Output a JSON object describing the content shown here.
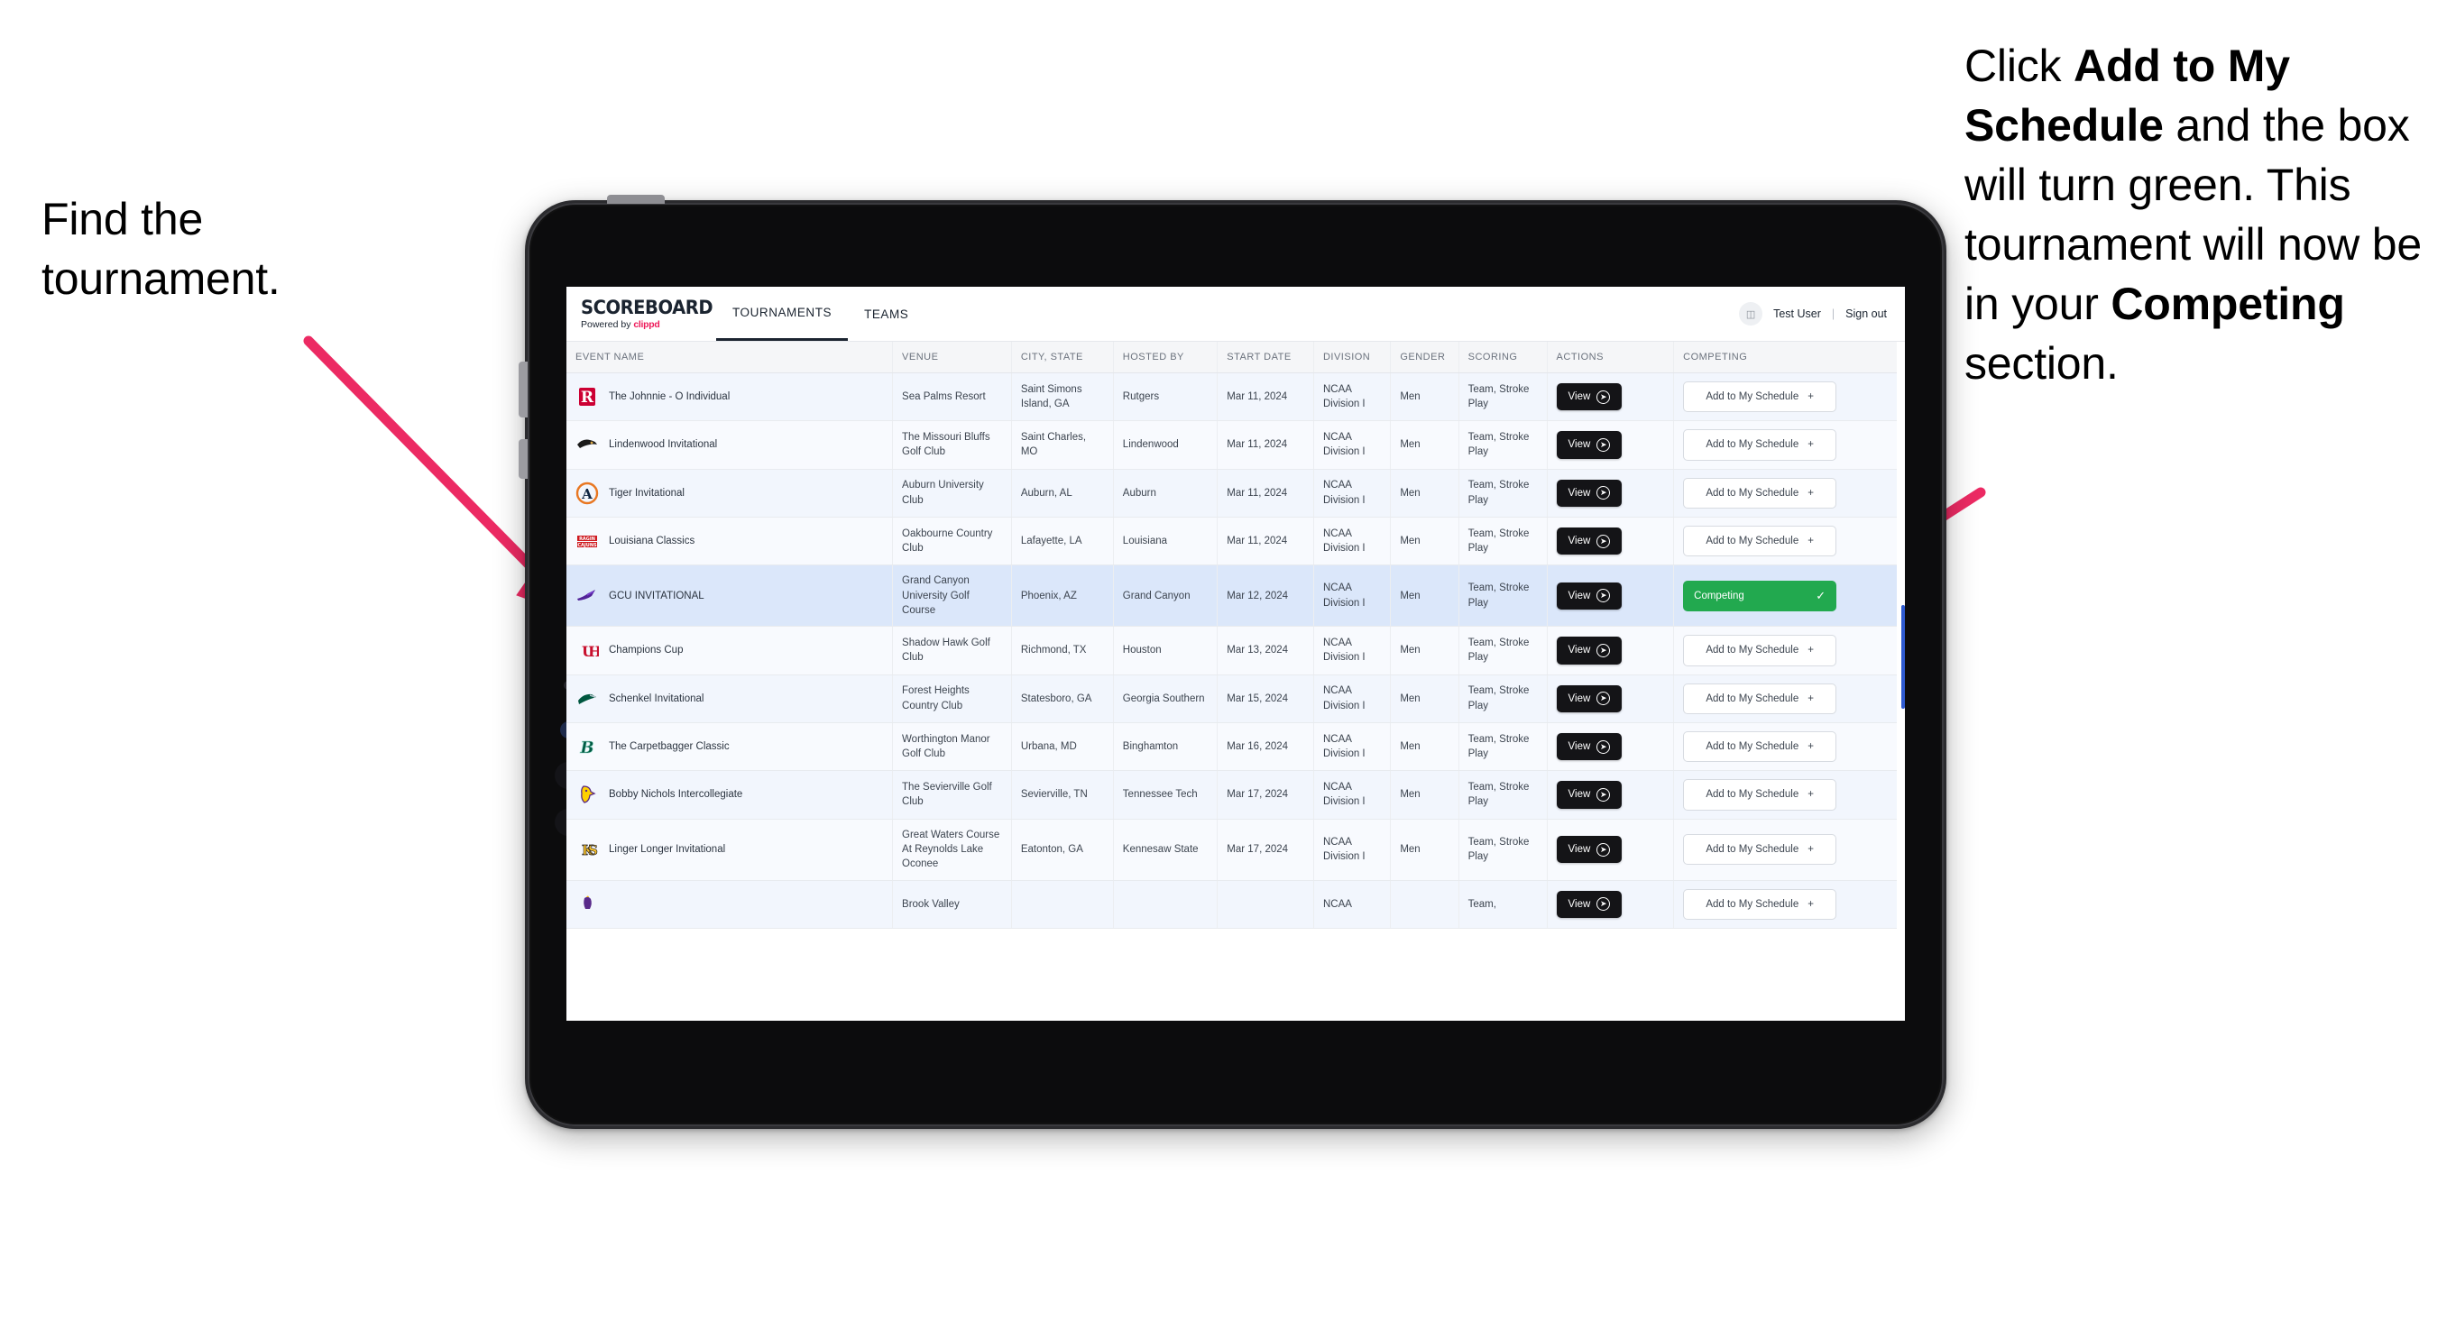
{
  "callouts": {
    "left": "Find the tournament.",
    "right_parts": [
      {
        "t": "Click ",
        "b": false
      },
      {
        "t": "Add to My Schedule",
        "b": true
      },
      {
        "t": " and the box will turn green. This tournament will now be in your ",
        "b": false
      },
      {
        "t": "Competing",
        "b": true
      },
      {
        "t": " section.",
        "b": false
      }
    ],
    "arrow_color": "#ec2a63"
  },
  "app": {
    "brand_title": "SCOREBOARD",
    "brand_sub_prefix": "Powered by ",
    "brand_sub_name": "clippd",
    "tabs": [
      {
        "label": "TOURNAMENTS",
        "active": true
      },
      {
        "label": "TEAMS",
        "active": false
      }
    ],
    "user": {
      "avatar_icon": "user-avatar-icon",
      "name": "Test User",
      "separator": "|",
      "sign_out": "Sign out"
    }
  },
  "table": {
    "columns": [
      "EVENT NAME",
      "VENUE",
      "CITY, STATE",
      "HOSTED BY",
      "START DATE",
      "DIVISION",
      "GENDER",
      "SCORING",
      "ACTIONS",
      "COMPETING"
    ],
    "view_label": "View",
    "add_label": "Add to My Schedule",
    "add_plus": "+",
    "competing_label": "Competing",
    "competing_color": "#22a94f",
    "rows": [
      {
        "logo": "rutgers",
        "name": "The Johnnie - O Individual",
        "venue": "Sea Palms Resort",
        "city": "Saint Simons Island, GA",
        "host": "Rutgers",
        "date": "Mar 11, 2024",
        "division": "NCAA Division I",
        "gender": "Men",
        "scoring": "Team, Stroke Play",
        "competing": false
      },
      {
        "logo": "lindenwood",
        "name": "Lindenwood Invitational",
        "venue": "The Missouri Bluffs Golf Club",
        "city": "Saint Charles, MO",
        "host": "Lindenwood",
        "date": "Mar 11, 2024",
        "division": "NCAA Division I",
        "gender": "Men",
        "scoring": "Team, Stroke Play",
        "competing": false
      },
      {
        "logo": "auburn",
        "name": "Tiger Invitational",
        "venue": "Auburn University Club",
        "city": "Auburn, AL",
        "host": "Auburn",
        "date": "Mar 11, 2024",
        "division": "NCAA Division I",
        "gender": "Men",
        "scoring": "Team, Stroke Play",
        "competing": false
      },
      {
        "logo": "louisiana",
        "name": "Louisiana Classics",
        "venue": "Oakbourne Country Club",
        "city": "Lafayette, LA",
        "host": "Louisiana",
        "date": "Mar 11, 2024",
        "division": "NCAA Division I",
        "gender": "Men",
        "scoring": "Team, Stroke Play",
        "competing": false
      },
      {
        "logo": "gcu",
        "name": "GCU INVITATIONAL",
        "venue": "Grand Canyon University Golf Course",
        "city": "Phoenix, AZ",
        "host": "Grand Canyon",
        "date": "Mar 12, 2024",
        "division": "NCAA Division I",
        "gender": "Men",
        "scoring": "Team, Stroke Play",
        "competing": true
      },
      {
        "logo": "houston",
        "name": "Champions Cup",
        "venue": "Shadow Hawk Golf Club",
        "city": "Richmond, TX",
        "host": "Houston",
        "date": "Mar 13, 2024",
        "division": "NCAA Division I",
        "gender": "Men",
        "scoring": "Team, Stroke Play",
        "competing": false
      },
      {
        "logo": "georgiasouthern",
        "name": "Schenkel Invitational",
        "venue": "Forest Heights Country Club",
        "city": "Statesboro, GA",
        "host": "Georgia Southern",
        "date": "Mar 15, 2024",
        "division": "NCAA Division I",
        "gender": "Men",
        "scoring": "Team, Stroke Play",
        "competing": false
      },
      {
        "logo": "binghamton",
        "name": "The Carpetbagger Classic",
        "venue": "Worthington Manor Golf Club",
        "city": "Urbana, MD",
        "host": "Binghamton",
        "date": "Mar 16, 2024",
        "division": "NCAA Division I",
        "gender": "Men",
        "scoring": "Team, Stroke Play",
        "competing": false
      },
      {
        "logo": "tennesseetech",
        "name": "Bobby Nichols Intercollegiate",
        "venue": "The Sevierville Golf Club",
        "city": "Sevierville, TN",
        "host": "Tennessee Tech",
        "date": "Mar 17, 2024",
        "division": "NCAA Division I",
        "gender": "Men",
        "scoring": "Team, Stroke Play",
        "competing": false
      },
      {
        "logo": "kennesaw",
        "name": "Linger Longer Invitational",
        "venue": "Great Waters Course At Reynolds Lake Oconee",
        "city": "Eatonton, GA",
        "host": "Kennesaw State",
        "date": "Mar 17, 2024",
        "division": "NCAA Division I",
        "gender": "Men",
        "scoring": "Team, Stroke Play",
        "competing": false
      },
      {
        "logo": "ecu",
        "name": "",
        "venue": "Brook Valley",
        "city": "",
        "host": "",
        "date": "",
        "division": "NCAA",
        "gender": "",
        "scoring": "Team,",
        "competing": false
      }
    ]
  }
}
